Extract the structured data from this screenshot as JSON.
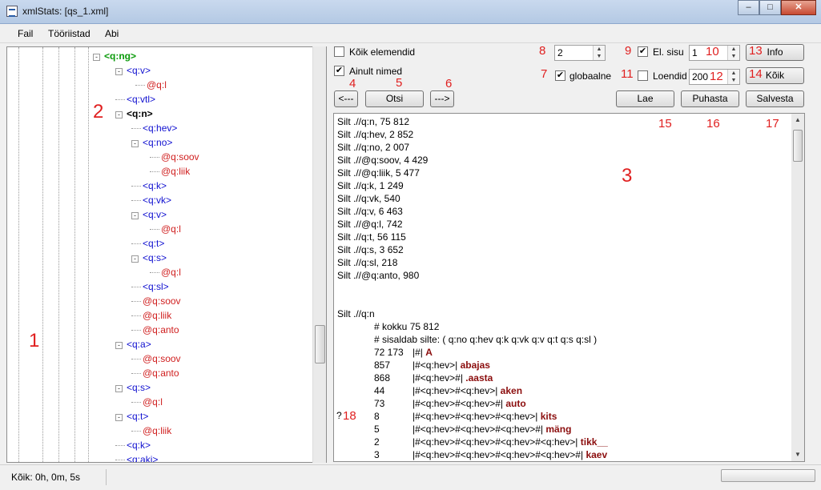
{
  "window": {
    "title": "xmlStats: [qs_1.xml]",
    "minimize": "–",
    "maximize": "□",
    "close": "✕"
  },
  "menu": [
    "Fail",
    "Tööriistad",
    "Abi"
  ],
  "tree": [
    {
      "text": "<q:ng>",
      "kind": "root",
      "exp": "-"
    },
    {
      "text": "<q:v>",
      "kind": "elt",
      "exp": "-"
    },
    {
      "text": "@q:l",
      "kind": "attr"
    },
    {
      "text": "<q:vtl>",
      "kind": "elt"
    },
    {
      "text": "<q:n>",
      "kind": "sel",
      "exp": "-"
    },
    {
      "text": "<q:hev>",
      "kind": "elt"
    },
    {
      "text": "<q:no>",
      "kind": "elt",
      "exp": "-"
    },
    {
      "text": "@q:soov",
      "kind": "attr"
    },
    {
      "text": "@q:liik",
      "kind": "attr"
    },
    {
      "text": "<q:k>",
      "kind": "elt"
    },
    {
      "text": "<q:vk>",
      "kind": "elt"
    },
    {
      "text": "<q:v>",
      "kind": "elt",
      "exp": "-"
    },
    {
      "text": "@q:l",
      "kind": "attr"
    },
    {
      "text": "<q:t>",
      "kind": "elt"
    },
    {
      "text": "<q:s>",
      "kind": "elt",
      "exp": "-"
    },
    {
      "text": "@q:l",
      "kind": "attr"
    },
    {
      "text": "<q:sl>",
      "kind": "elt"
    },
    {
      "text": "@q:soov",
      "kind": "attr"
    },
    {
      "text": "@q:liik",
      "kind": "attr"
    },
    {
      "text": "@q:anto",
      "kind": "attr"
    },
    {
      "text": "<q:a>",
      "kind": "elt",
      "exp": "-"
    },
    {
      "text": "@q:soov",
      "kind": "attr"
    },
    {
      "text": "@q:anto",
      "kind": "attr"
    },
    {
      "text": "<q:s>",
      "kind": "elt",
      "exp": "-"
    },
    {
      "text": "@q:l",
      "kind": "attr"
    },
    {
      "text": "<q:t>",
      "kind": "elt",
      "exp": "-"
    },
    {
      "text": "@q:liik",
      "kind": "attr"
    },
    {
      "text": "<q:k>",
      "kind": "elt"
    },
    {
      "text": "<q:aki>",
      "kind": "elt"
    }
  ],
  "controls": {
    "koik_elemendid": {
      "label": "Kõik elemendid",
      "checked": false
    },
    "ainult_nimed": {
      "label": "Ainult nimed",
      "checked": true
    },
    "depth_value": "2",
    "el_sisu": {
      "label": "El. sisu",
      "checked": true
    },
    "el_sisu_value": "1",
    "globaalne": {
      "label": "globaalne",
      "checked": true
    },
    "loendid": {
      "label": "Loendid",
      "checked": false
    },
    "loendid_value": "200",
    "prev_button": "<---",
    "search_button": "Otsi",
    "next_button": "--->",
    "info_button": "Info",
    "all_button": "Kõik",
    "load_button": "Lae",
    "clear_button": "Puhasta",
    "save_button": "Salvesta"
  },
  "annotations": {
    "n1": "1",
    "n2": "2",
    "n3": "3",
    "n4": "4",
    "n5": "5",
    "n6": "6",
    "n7": "7",
    "n8": "8",
    "n9": "9",
    "n10": "10",
    "n11": "11",
    "n12": "12",
    "n13": "13",
    "n14": "14",
    "n15": "15",
    "n16": "16",
    "n17": "17",
    "n18": "18",
    "q": "?"
  },
  "output": {
    "summary": [
      "Silt .//q:n, 75 812",
      "Silt .//q:hev, 2 852",
      "Silt .//q:no, 2 007",
      "Silt .//@q:soov, 4 429",
      "Silt .//@q:liik, 5 477",
      "Silt .//q:k, 1 249",
      "Silt .//q:vk, 540",
      "Silt .//q:v, 6 463",
      "Silt .//@q:l, 742",
      "Silt .//q:t, 56 115",
      "Silt .//q:s, 3 652",
      "Silt .//q:sl, 218",
      "Silt .//@q:anto, 980"
    ],
    "detail_title": "Silt .//q:n",
    "kokku": "# kokku 75 812",
    "sisaldab": "# sisaldab silte: ( q:no q:hev q:k q:vk q:v q:t q:s q:sl )",
    "rows": [
      {
        "count": "72 173",
        "path": "|#|",
        "word": "A"
      },
      {
        "count": "857",
        "path": "|#<q:hev>|",
        "word": "abajas"
      },
      {
        "count": "868",
        "path": "|#<q:hev>#|",
        "word": ".aasta"
      },
      {
        "count": "44",
        "path": "|#<q:hev>#<q:hev>|",
        "word": "aken"
      },
      {
        "count": "73",
        "path": "|#<q:hev>#<q:hev>#|",
        "word": "auto"
      },
      {
        "count": "8",
        "path": "|#<q:hev>#<q:hev>#<q:hev>|",
        "word": "kits"
      },
      {
        "count": "5",
        "path": "|#<q:hev>#<q:hev>#<q:hev>#|",
        "word": "mäng"
      },
      {
        "count": "2",
        "path": "|#<q:hev>#<q:hev>#<q:hev>#<q:hev>|",
        "word": "tikk__"
      },
      {
        "count": "3",
        "path": "|#<q:hev>#<q:hev>#<q:hev>#<q:hev>#|",
        "word": "kaev"
      }
    ]
  },
  "status": {
    "time": "Kõik: 0h, 0m, 5s"
  }
}
